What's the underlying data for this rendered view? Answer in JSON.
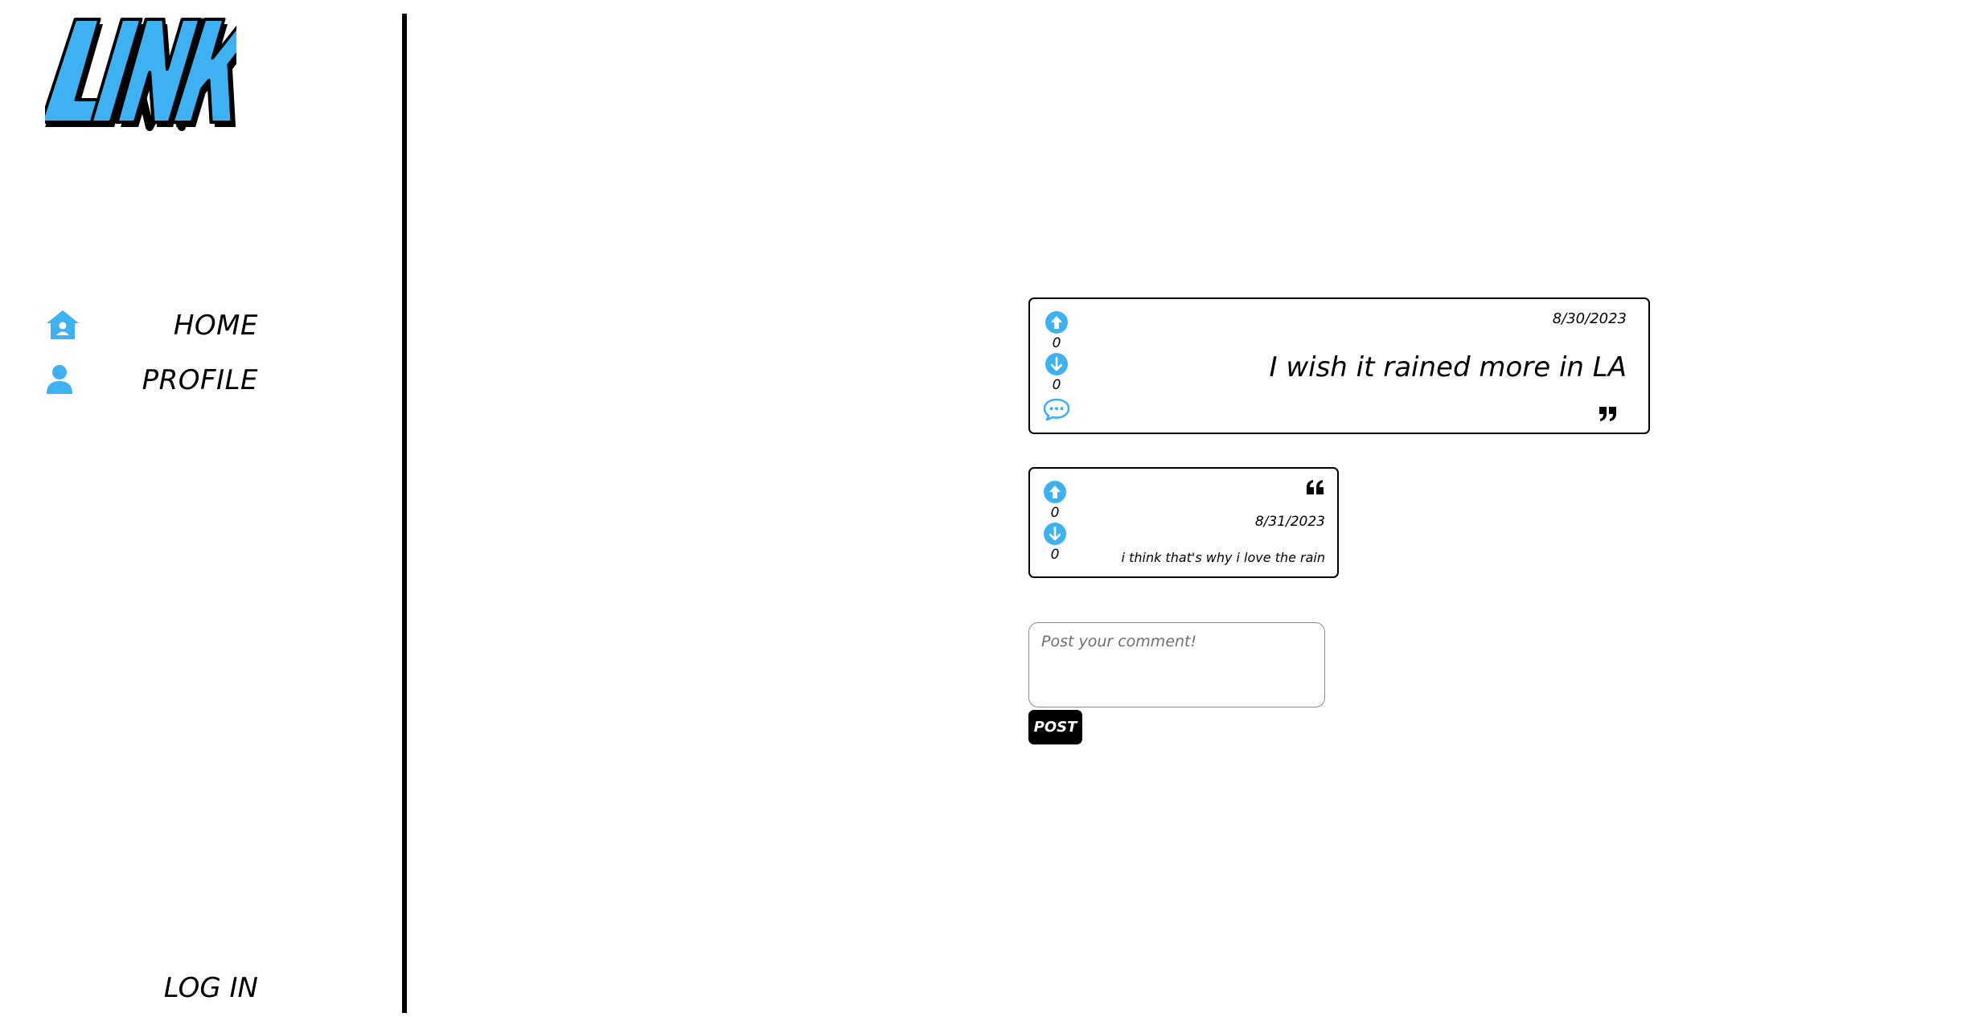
{
  "brand": {
    "logo_text": "LINK",
    "accent_color": "#3db1f2"
  },
  "sidebar": {
    "items": [
      {
        "label": "HOME",
        "icon": "home-icon"
      },
      {
        "label": "PROFILE",
        "icon": "user-icon"
      }
    ],
    "login_label": "LOG IN"
  },
  "post": {
    "date": "8/30/2023",
    "text": "I wish it rained more in LA",
    "upvotes": "0",
    "downvotes": "0",
    "icons": [
      "upvote-icon",
      "downvote-icon",
      "comment-icon",
      "quote-close-icon"
    ]
  },
  "reply": {
    "date": "8/31/2023",
    "text": "i think that's why i love the rain",
    "upvotes": "0",
    "downvotes": "0",
    "icons": [
      "upvote-icon",
      "downvote-icon",
      "quote-open-icon"
    ]
  },
  "comment_form": {
    "placeholder": "Post your comment!",
    "value": "",
    "submit_label": "POST"
  }
}
